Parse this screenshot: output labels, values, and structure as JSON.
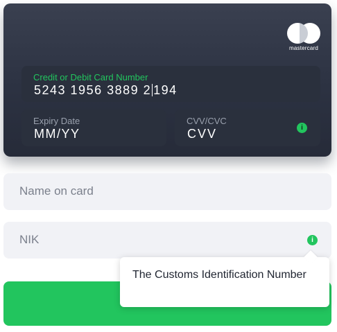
{
  "card": {
    "brand_text": "mastercard",
    "number_label": "Credit or Debit Card Number",
    "number_before_caret": "5243 1956 3889 2",
    "number_after_caret": "194",
    "expiry_label": "Expiry Date",
    "expiry_value": "MM/YY",
    "cvv_label": "CVV/CVC",
    "cvv_value": "CVV",
    "cvv_info_icon": "info-icon"
  },
  "form": {
    "name_placeholder": "Name on card",
    "nik_placeholder": "NIK",
    "nik_info_icon": "info-icon"
  },
  "tooltip": {
    "text": "The Customs Identification Number"
  },
  "colors": {
    "accent": "#22c55e",
    "card_background": "#2c3242",
    "input_background": "#f1f2f6"
  }
}
